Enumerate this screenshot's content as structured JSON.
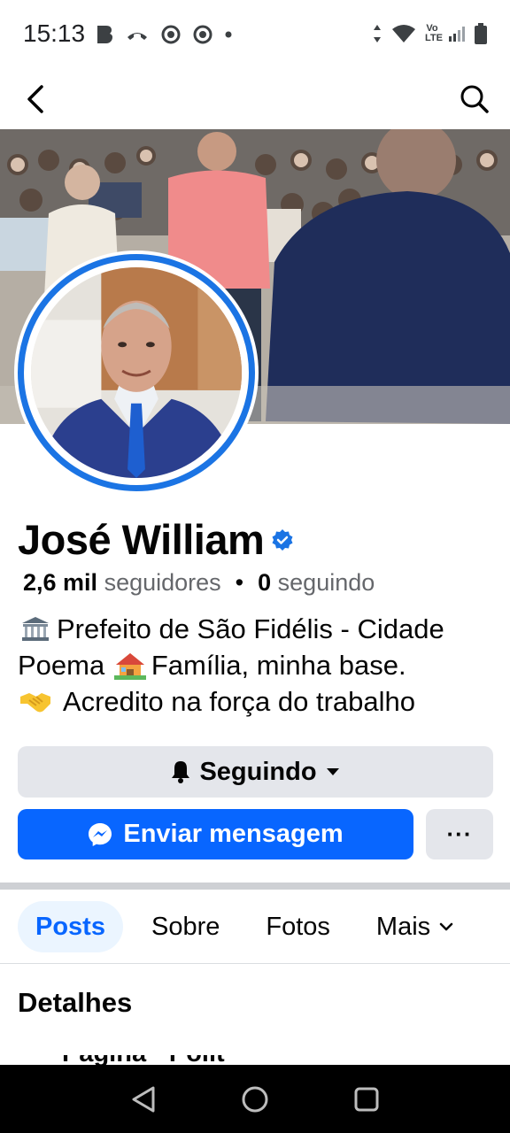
{
  "status_bar": {
    "time": "15:13",
    "left_icons": [
      "b-icon",
      "missed-call-icon",
      "chrome-icon",
      "chrome-icon",
      "dot-icon"
    ],
    "right_icons": [
      "data-arrows-icon",
      "wifi-icon",
      "volte-icon",
      "signal-icon",
      "battery-icon"
    ],
    "volte_label": "Vo LTE"
  },
  "app_bar": {
    "back_icon": "chevron-left-icon",
    "search_icon": "search-icon"
  },
  "profile": {
    "name": "José William",
    "verified": true,
    "followers_count": "2,6 mil",
    "followers_label": "seguidores",
    "separator": "•",
    "following_count": "0",
    "following_label": "seguindo",
    "bio": [
      {
        "emoji": "classical-building-icon",
        "text": "Prefeito de São Fidélis - Cidade"
      },
      {
        "text_before": "Poema ",
        "emoji": "house-garden-icon",
        "text": "Família, minha base."
      },
      {
        "emoji": "handshake-icon",
        "text": " Acredito na força do trabalho"
      }
    ]
  },
  "actions": {
    "following_label": "Seguindo",
    "message_label": "Enviar mensagem",
    "more_label": "···"
  },
  "tabs": [
    {
      "label": "Posts",
      "active": true
    },
    {
      "label": "Sobre",
      "active": false
    },
    {
      "label": "Fotos",
      "active": false
    },
    {
      "label": "Mais",
      "active": false
    }
  ],
  "details": {
    "title": "Detalhes",
    "peek_text": "Página · Polít"
  },
  "colors": {
    "accent": "#0866ff",
    "verified": "#1b74e4",
    "button_gray": "#e4e6eb",
    "tab_active_bg": "#ebf5ff"
  }
}
